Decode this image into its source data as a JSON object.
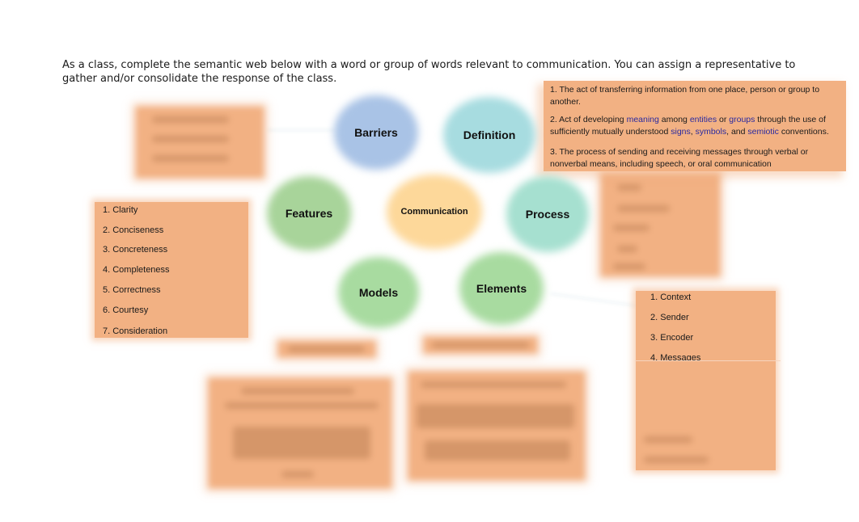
{
  "instructions": "As a class, complete the semantic web below with a word or group of words relevant to communication. You can assign a representative to gather and/or consolidate the response of the class.",
  "colors": {
    "box_fill": "#f2b183",
    "center": "#fdd89a",
    "barriers": "#a9c3e6",
    "definition": "#a7dce0",
    "process": "#a6e0d0",
    "features": "#a8d49a",
    "models": "#a8dba0",
    "elements": "#a8dba0",
    "link_text": "#2a2aa0"
  },
  "web": {
    "center": "Communication",
    "nodes": {
      "barriers": "Barriers",
      "definition": "Definition",
      "features": "Features",
      "process": "Process",
      "models": "Models",
      "elements": "Elements"
    }
  },
  "definition_box": {
    "item1": "1. The act of transferring information from one place, person or group to another.",
    "item2": {
      "p1": "2. Act of developing ",
      "link1": "meaning",
      "p2": " among ",
      "link2": "entities",
      "p3": " or ",
      "link3": "groups",
      "p4": " through the use of sufficiently mutually understood ",
      "link4": "signs",
      "p5": ", ",
      "link5": "symbols",
      "p6": ", and ",
      "link6": "semiotic",
      "p7": " conventions."
    },
    "item3": "3. The process of sending and receiving messages through verbal or nonverbal means, including speech, or oral communication"
  },
  "features_box": {
    "items": [
      "1. Clarity",
      "2. Conciseness",
      "3. Concreteness",
      "4. Completeness",
      "5. Correctness",
      "6. Courtesy",
      "7. Consideration"
    ]
  },
  "elements_box": {
    "items": [
      "1. Context",
      "2. Sender",
      "3. Encoder",
      "4. Messages"
    ]
  }
}
